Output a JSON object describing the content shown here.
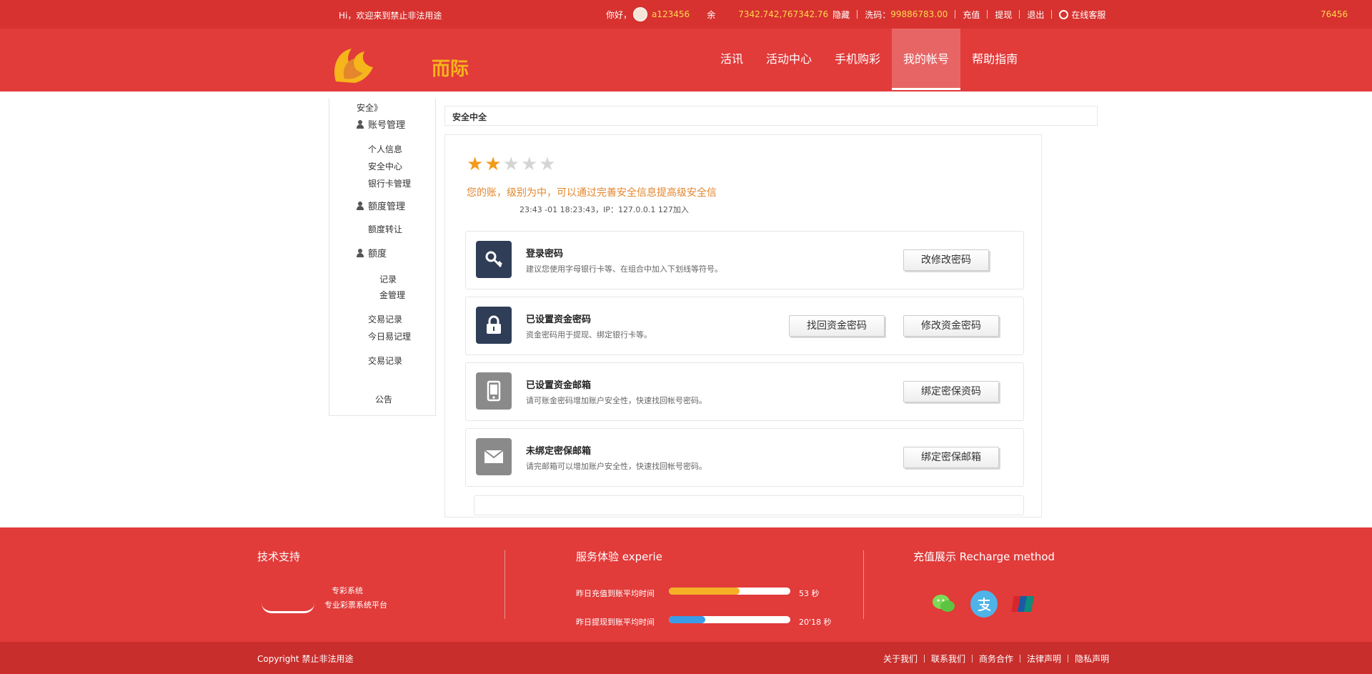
{
  "topbar": {
    "welcome": "Hi，欢迎来到禁止非法用途",
    "greeting": "你好，",
    "username": "a123456",
    "balance_label": "余",
    "balance": "7342.742,767342.76",
    "hide": "隐藏",
    "wash_label": "洗码：",
    "wash_value": "99886783.00",
    "recharge": "充值",
    "withdraw": "提现",
    "logout": "退出",
    "service": "在线客服",
    "edge_value": "76456"
  },
  "header": {
    "logo_text": "而际",
    "nav": [
      "活讯",
      "活动中心",
      "手机购彩",
      "我的帐号",
      "帮助指南"
    ]
  },
  "sidebar": {
    "caption": "安全》",
    "groups": [
      {
        "label": "账号管理",
        "items": [
          "个人信息",
          "安全中心",
          "银行卡管理"
        ]
      },
      {
        "label": "额度管理",
        "items": [
          "额度转让"
        ]
      },
      {
        "label": "额度",
        "items": [
          "记录",
          "金管理",
          "交易记录",
          "今日易记理",
          "交易记录"
        ]
      }
    ],
    "notice": "公告"
  },
  "main": {
    "breadcrumb": "安全中全",
    "rating": 2,
    "rating_max": 5,
    "level_text": "您的账，级别为中，可以通过完善安全信息提高级安全信",
    "login_info": "23:43 -01 18:23:43，IP：127.0.0.1 127加入",
    "cards": [
      {
        "title": "登录密码",
        "desc": "建议您使用字母银行卡等、在组合中加入下划线等符号。",
        "icon": "key-icon",
        "buttons": [
          "改修改密码"
        ]
      },
      {
        "title": "已设置资金密码",
        "desc": "资金密码用于提现、绑定银行卡等。",
        "icon": "lock-icon",
        "buttons": [
          "找回资金密码",
          "修改资金密码"
        ]
      },
      {
        "title": "已设置资金邮箱",
        "desc": "请可账金密码增加账户安全性，快速找回帐号密码。",
        "icon": "phone-icon",
        "buttons": [
          "绑定密保资码"
        ]
      },
      {
        "title": "未绑定密保邮箱",
        "desc": "请完邮箱可以增加账户安全性，快速找回帐号密码。",
        "icon": "mail-icon",
        "buttons": [
          "绑定密保邮箱"
        ]
      }
    ]
  },
  "footer": {
    "tech_title": "技术支持",
    "tech_line1": "专彩系统",
    "tech_line2": "专业彩票系统平台",
    "service_title": "服务体验 experie",
    "recharge_label": "昨日充值到账平均时间",
    "recharge_value": "53 秒",
    "recharge_fill": 0.58,
    "withdraw_label": "昨日提现到账平均时间",
    "withdraw_value": "20'18 秒",
    "withdraw_fill": 0.3,
    "pay_title": "充值展示 Recharge method",
    "pay_methods": [
      "wechat-icon",
      "alipay-icon",
      "unionpay-icon"
    ],
    "copyright": "Copyright 禁止非法用途",
    "links": [
      "关于我们",
      "联系我们",
      "商务合作",
      "法律声明",
      "隐私声明"
    ]
  },
  "colors": {
    "brand_red": "#e13b3a",
    "dark_red": "#c82e2c",
    "star": "#f29a1b",
    "gold": "#ffd84d"
  }
}
